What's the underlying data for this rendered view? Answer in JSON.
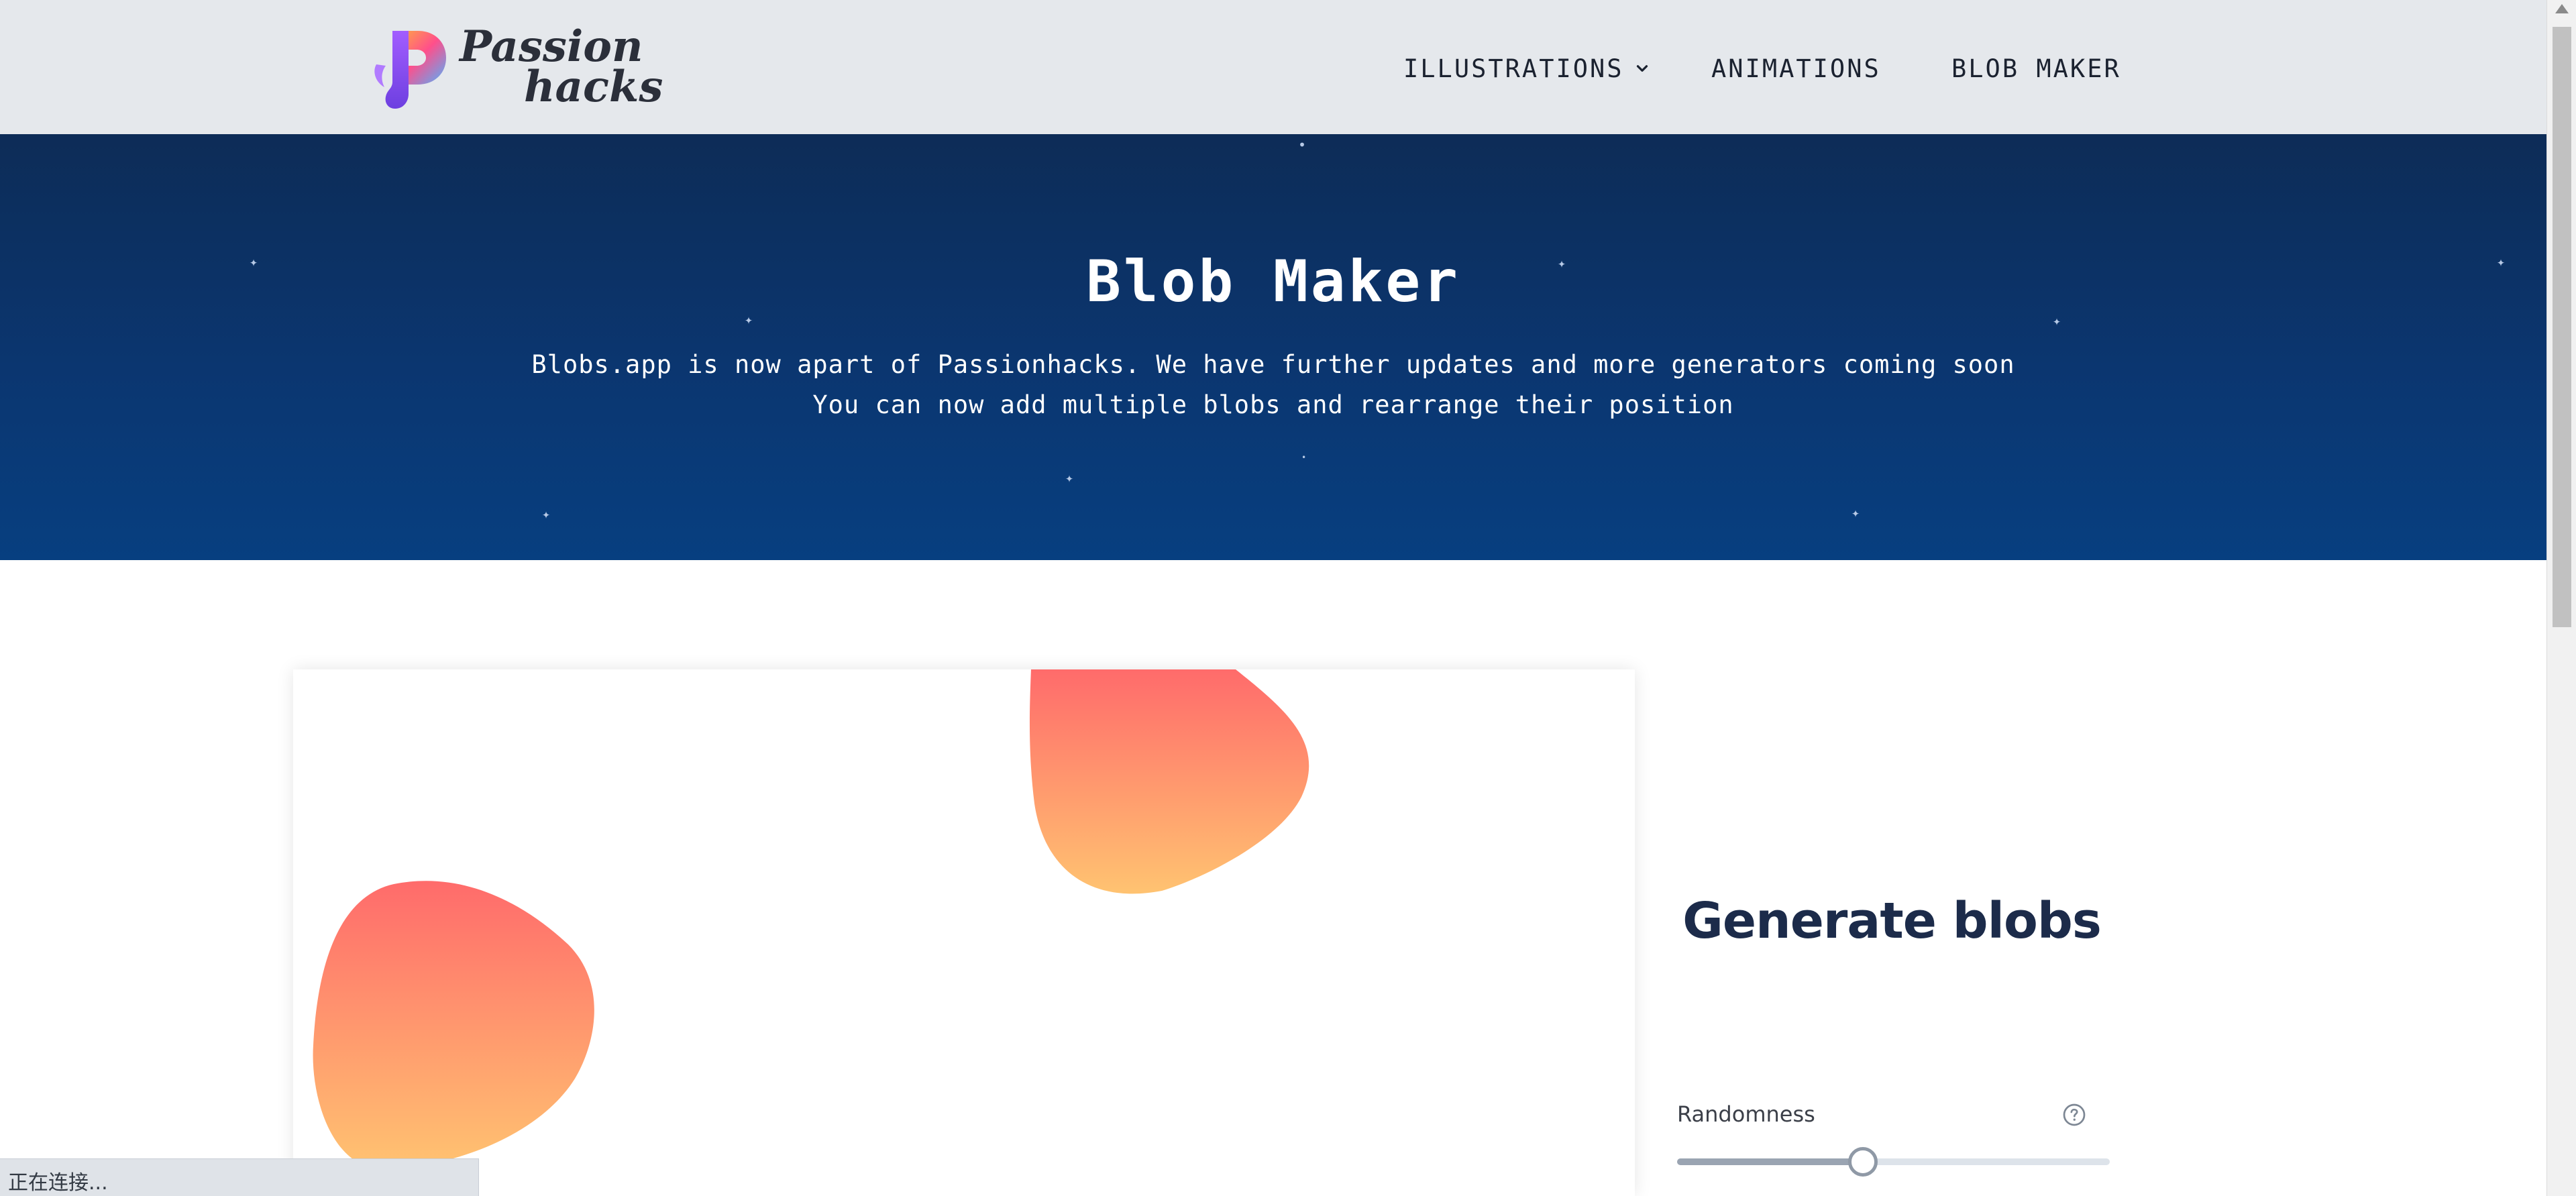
{
  "header": {
    "logo": {
      "line1": "Passion",
      "line2": "hacks"
    },
    "nav": {
      "illustrations": "ILLUSTRATIONS",
      "animations": "ANIMATIONS",
      "blob_maker": "BLOB MAKER"
    }
  },
  "hero": {
    "title": "Blob Maker",
    "line1": "Blobs.app is now apart of Passionhacks. We have further updates and more generators coming soon",
    "line2": "You can now add multiple blobs and rearrange their position"
  },
  "canvas": {
    "blob_gradient_top": "#ff6b6b",
    "blob_gradient_bottom": "#ffc371"
  },
  "generator": {
    "title": "Generate blobs",
    "randomness_label": "Randomness",
    "randomness_fraction": 0.43
  },
  "status_bar": {
    "text": "正在连接..."
  },
  "colors": {
    "header_bg": "#e5e8ec",
    "hero_top": "#0d2c57",
    "hero_bottom": "#073f80",
    "title_dark": "#1c2b4a"
  }
}
